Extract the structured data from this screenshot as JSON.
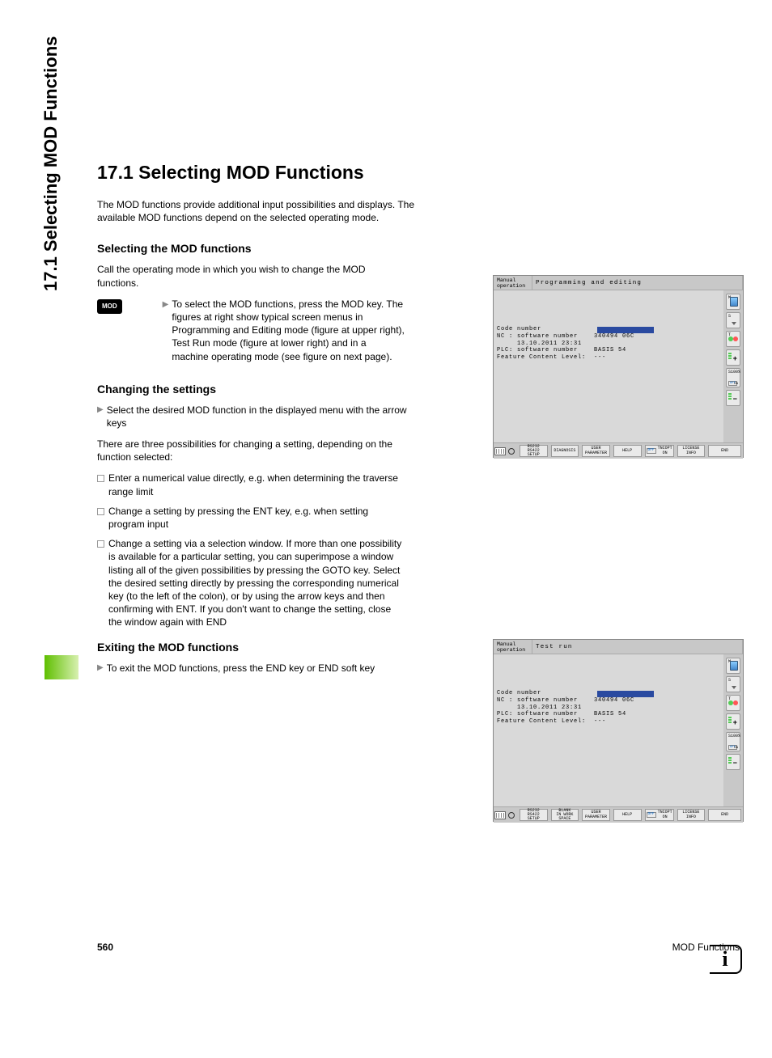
{
  "sidebar_label": "17.1 Selecting MOD Functions",
  "heading": "17.1  Selecting MOD Functions",
  "intro": "The MOD functions provide additional input possibilities and displays. The available MOD functions depend on the selected operating mode.",
  "section_select": {
    "title": "Selecting the MOD functions",
    "para": "Call the operating mode in which you wish to change the MOD functions.",
    "mod_key_label": "MOD",
    "mod_key_text": "To select the MOD functions, press the MOD key. The figures at right show typical screen menus in Programming and Editing mode (figure at upper right), Test Run mode (figure at lower right) and in a machine operating mode (see figure on next page)."
  },
  "section_change": {
    "title": "Changing the settings",
    "bullet1": "Select the desired MOD function in the displayed menu with the arrow keys",
    "para2": "There are three possibilities for changing a setting, depending on the function selected:",
    "items": [
      "Enter a numerical value directly, e.g. when determining the traverse range limit",
      "Change a setting by pressing the ENT key, e.g. when setting program input",
      "Change a setting via a selection window. If more than one possibility is available for a particular setting, you can superimpose a window listing all of the given possibilities by pressing the GOTO key. Select the desired setting directly by pressing the corresponding numerical key (to the left of the colon), or by using the arrow keys and then confirming with ENT. If you don't want to change the setting, close the window again with END"
    ]
  },
  "section_exit": {
    "title": "Exiting the MOD functions",
    "bullet": "To exit the MOD functions, press the END key or END soft key"
  },
  "footer": {
    "page": "560",
    "label": "MOD Functions"
  },
  "screenshots": {
    "shot1": {
      "mode_label": "Manual\noperation",
      "title": "Programming and editing",
      "lines": "Code number\nNC : software number    340494 06C\n     13.10.2011 23:31\nPLC: software number    BASIS 54\nFeature Content Level:  ---",
      "right": [
        {
          "lbl": "M"
        },
        {
          "lbl": "S"
        },
        {
          "lbl": "T"
        },
        {
          "sym": "+"
        },
        {
          "lbl": "S100%",
          "off": "OFF",
          "on": "ON"
        },
        {
          "sym": "−"
        }
      ],
      "softkeys": [
        "RS232\nRS422\nSETUP",
        "DIAGNOSIS",
        "USER\nPARAMETER",
        "HELP",
        "TNCOPT\nOFF  ON",
        "LICENSE\nINFO",
        "END"
      ]
    },
    "shot2": {
      "mode_label": "Manual\noperation",
      "title": "Test run",
      "lines": "Code number\nNC : software number    340494 06C\n     13.10.2011 23:31\nPLC: software number    BASIS 54\nFeature Content Level:  ---",
      "right": [
        {
          "lbl": "M"
        },
        {
          "lbl": "S"
        },
        {
          "lbl": "T"
        },
        {
          "sym": "+"
        },
        {
          "lbl": "S100%",
          "off": "OFF",
          "on": "ON"
        },
        {
          "sym": "−"
        }
      ],
      "softkeys": [
        "RS232\nRS422\nSETUP",
        "BLANK\nIN WORK\nSPACE",
        "USER\nPARAMETER",
        "HELP",
        "TNCOPT\nOFF  ON",
        "LICENSE\nINFO",
        "END"
      ]
    }
  }
}
